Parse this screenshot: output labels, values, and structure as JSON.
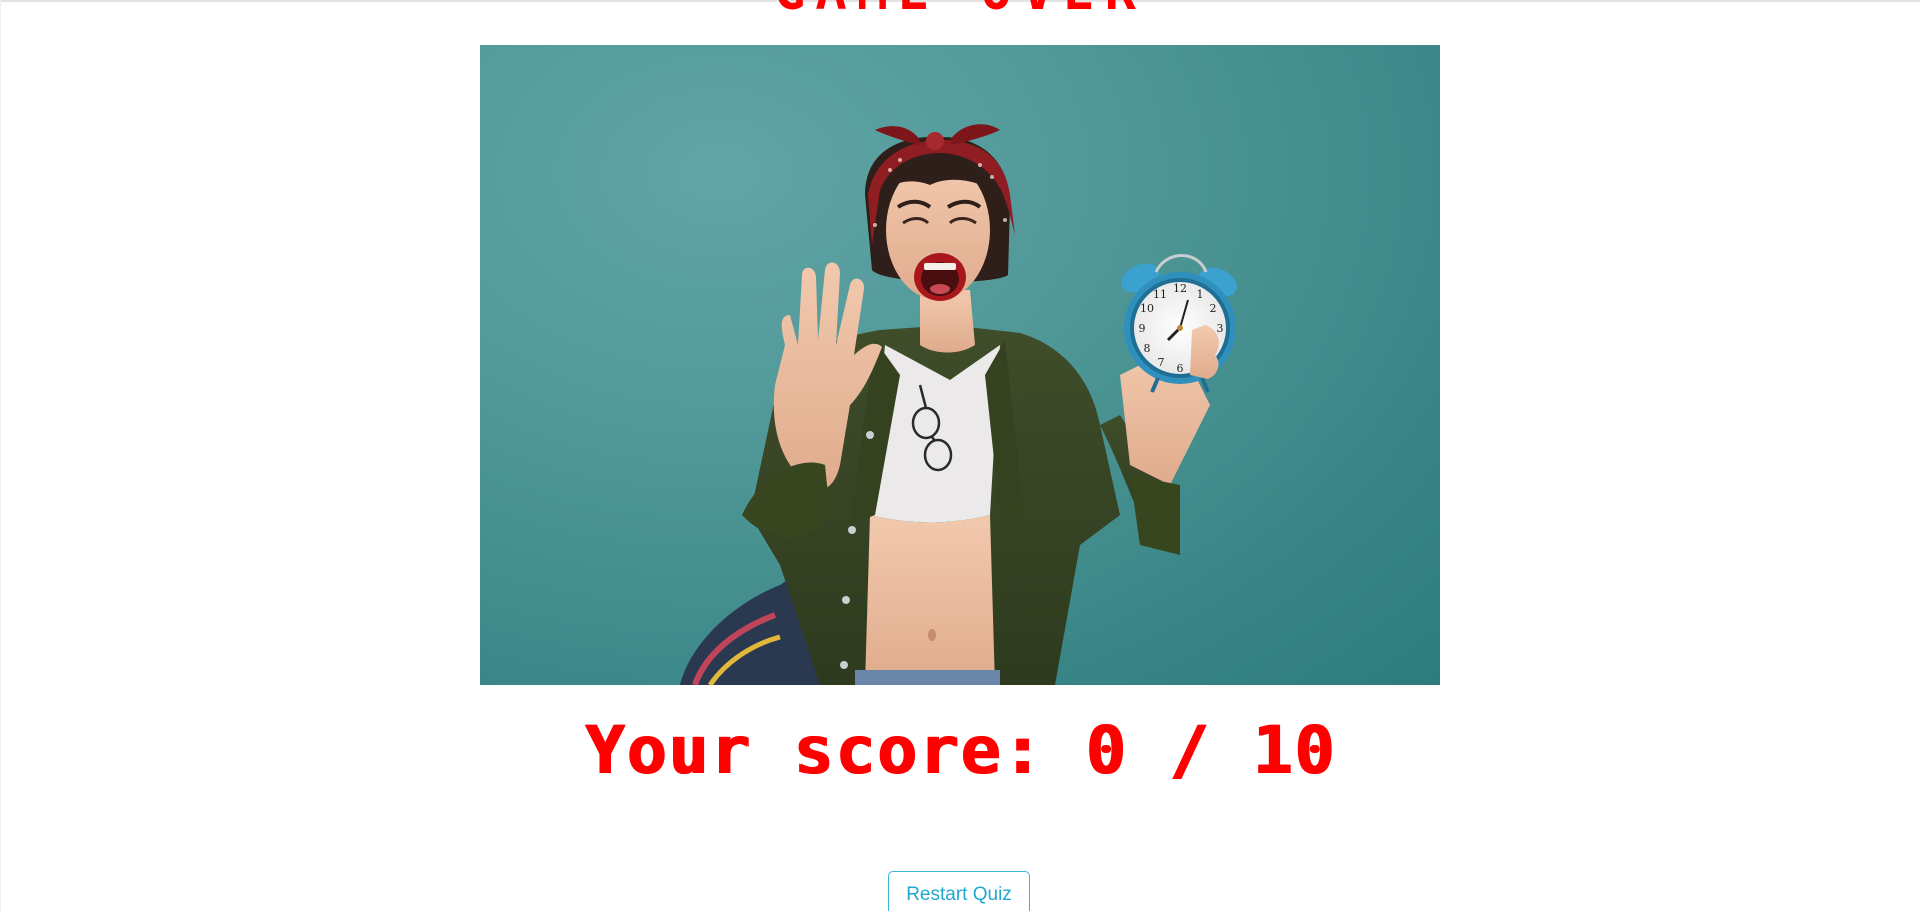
{
  "page": {
    "title_partial": "GAME OVER",
    "score_label": "Your score: 0 / 10",
    "restart_label": "Restart Quiz"
  },
  "colors": {
    "title": "#ff0000",
    "score": "#ff0000",
    "button_border": "#36b6d8",
    "button_text": "#1fa9cf",
    "photo_background": "#4f9797"
  },
  "icons": {
    "photo_subject": "woman-with-alarm-clock-photo"
  }
}
